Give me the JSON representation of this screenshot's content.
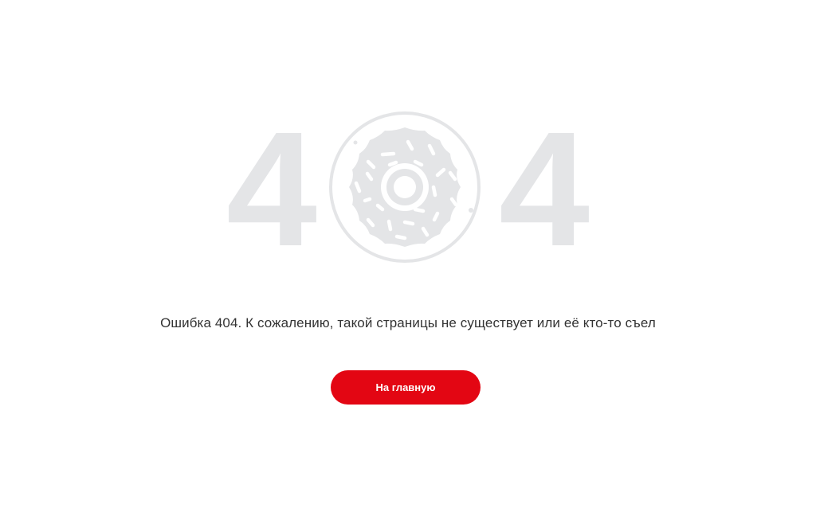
{
  "error": {
    "code_left": "4",
    "code_right": "4",
    "donut_icon": "donut-icon",
    "message": "Ошибка 404. К сожалению, такой страницы не существует или её кто-то съел"
  },
  "actions": {
    "home_label": "На главную"
  },
  "colors": {
    "accent": "#e30613",
    "digit": "#e4e5e7",
    "donut": "#e4e5e7",
    "text": "#333333",
    "background": "#ffffff"
  }
}
